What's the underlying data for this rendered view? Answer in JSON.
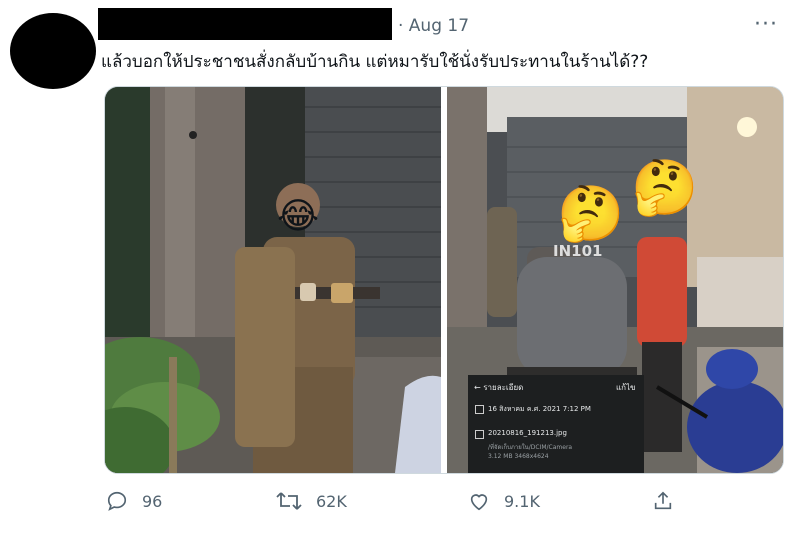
{
  "tweet": {
    "date": "· Aug 17",
    "text": "แล้วบอกให้ประชาชนสั่งกลับบ้านกิน แต่หมารับใช้นั่งรับประทานในร้านได้??",
    "more_label": "···"
  },
  "media": {
    "left_photo": {
      "emoji": "😂"
    },
    "right_photo": {
      "emoji_1": "🤔",
      "emoji_2": "🤔",
      "shirt_text": "IN101",
      "detail_panel": {
        "header_left": "← รายละเอียด",
        "header_right": "แก้ไข",
        "datetime": "16 สิงหาคม ค.ศ. 2021 7:12 PM",
        "filename": "20210816_191213.jpg",
        "path": "/ที่จัดเก็บภายใน/DCIM/Camera",
        "meta": "3.12 MB    3468x4624"
      }
    }
  },
  "actions": {
    "reply_count": "96",
    "retweet_count": "62K",
    "like_count": "9.1K"
  },
  "colors": {
    "text_primary": "#0f1419",
    "text_secondary": "#536471",
    "border": "#cfd9de"
  }
}
